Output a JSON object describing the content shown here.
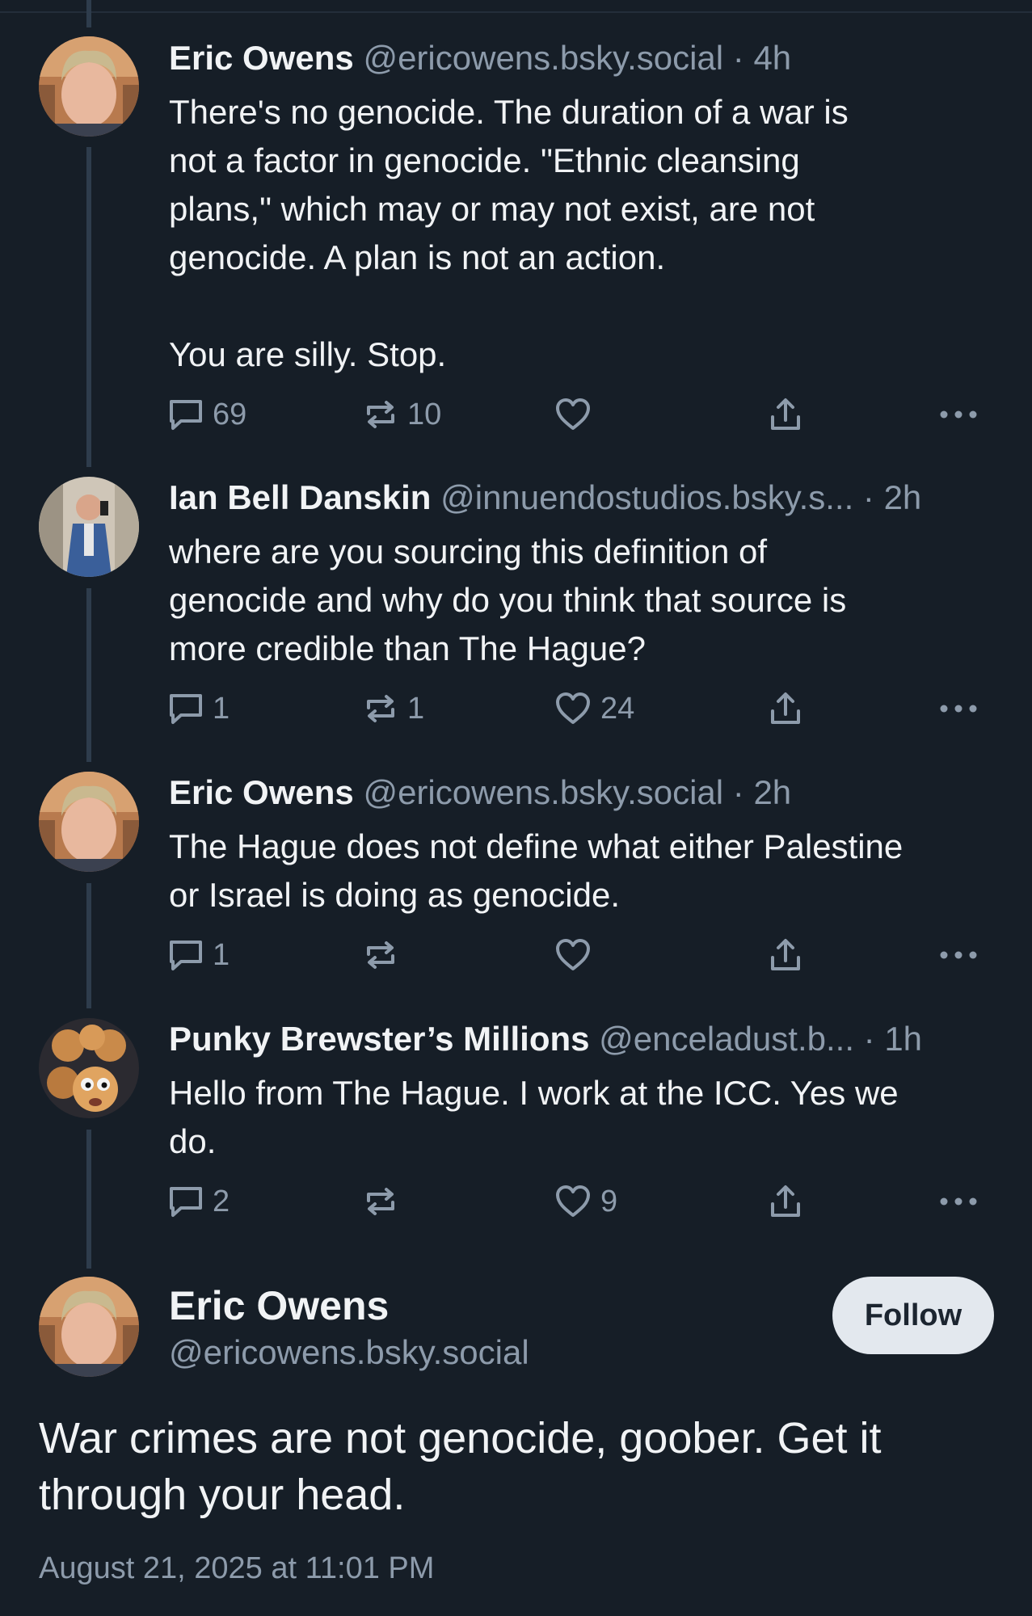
{
  "posts": [
    {
      "name": "Eric Owens",
      "handle": "@ericowens.bsky.social",
      "time": " · 4h",
      "text": "There's no genocide. The duration of a war is\nnot a factor in genocide. \"Ethnic cleansing\nplans,\" which may or may not exist, are not\ngenocide. A plan is not an action.\n\nYou are silly. Stop.",
      "replies": "69",
      "reposts": "10",
      "likes": ""
    },
    {
      "name": "Ian Bell Danskin",
      "handle": "@innuendostudios.bsky.s...",
      "time": " · 2h",
      "text": "where are you sourcing this definition of\ngenocide and why do you think that source is\nmore credible than The Hague?",
      "replies": "1",
      "reposts": "1",
      "likes": "24"
    },
    {
      "name": "Eric Owens",
      "handle": "@ericowens.bsky.social",
      "time": " · 2h",
      "text": "The Hague does not define what either Palestine\nor Israel is doing as genocide.",
      "replies": "1",
      "reposts": "",
      "likes": ""
    },
    {
      "name": "Punky Brewster’s Millions",
      "handle": "@enceladust.b...",
      "time": "  · 1h",
      "text": "Hello from The Hague. I work at the ICC. Yes we\ndo.",
      "replies": "2",
      "reposts": "",
      "likes": "9"
    }
  ],
  "main_post": {
    "name": "Eric Owens",
    "handle": "@ericowens.bsky.social",
    "follow_label": "Follow",
    "text": "War crimes are not genocide, goober. Get it\nthrough your head.",
    "date": "August 21, 2025 at 11:01 PM"
  },
  "icons": {
    "reply": "reply-bubble-icon",
    "repost": "repost-arrows-icon",
    "like": "heart-icon",
    "share": "share-upload-icon",
    "more": "more-dots-icon"
  },
  "colors": {
    "background": "#161e27",
    "muted_text": "#8d9bab",
    "thread_line": "#2e3c4c",
    "follow_button": "#e3e8ee"
  }
}
